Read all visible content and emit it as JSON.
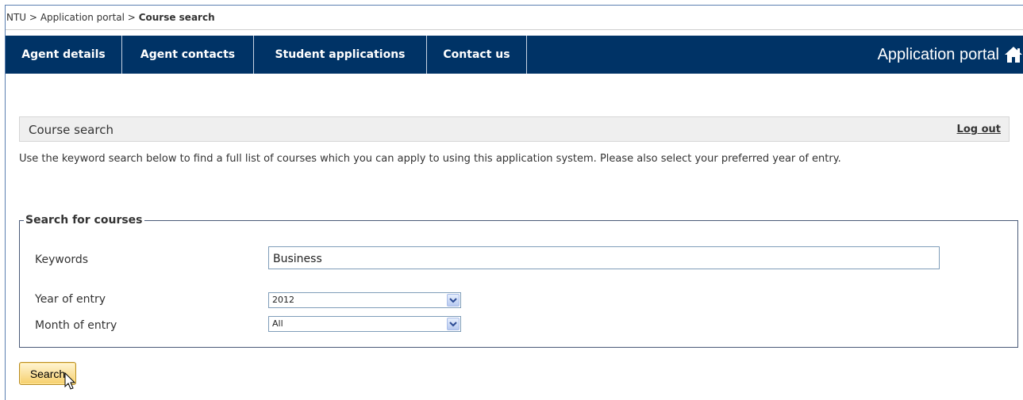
{
  "breadcrumb": {
    "items": [
      "NTU",
      "Application portal"
    ],
    "separator": ">",
    "current": "Course search"
  },
  "nav": {
    "items": [
      {
        "label": "Agent details"
      },
      {
        "label": "Agent contacts"
      },
      {
        "label": "Student applications"
      },
      {
        "label": "Contact us"
      }
    ],
    "portal_title": "Application portal",
    "home_icon": "home-icon",
    "background": "#003366"
  },
  "section": {
    "title": "Course search",
    "logout_label": "Log out"
  },
  "intro_text": "Use the keyword search below to find a full list of courses which you can apply to using this application system. Please also select your preferred year of entry.",
  "search_form": {
    "legend": "Search for courses",
    "keywords_label": "Keywords",
    "keywords_value": "Business",
    "year_label": "Year of entry",
    "year_value": "2012",
    "month_label": "Month of entry",
    "month_value": "All",
    "dropdown_icon": "chevron-down-icon"
  },
  "search_button_label": "Search"
}
